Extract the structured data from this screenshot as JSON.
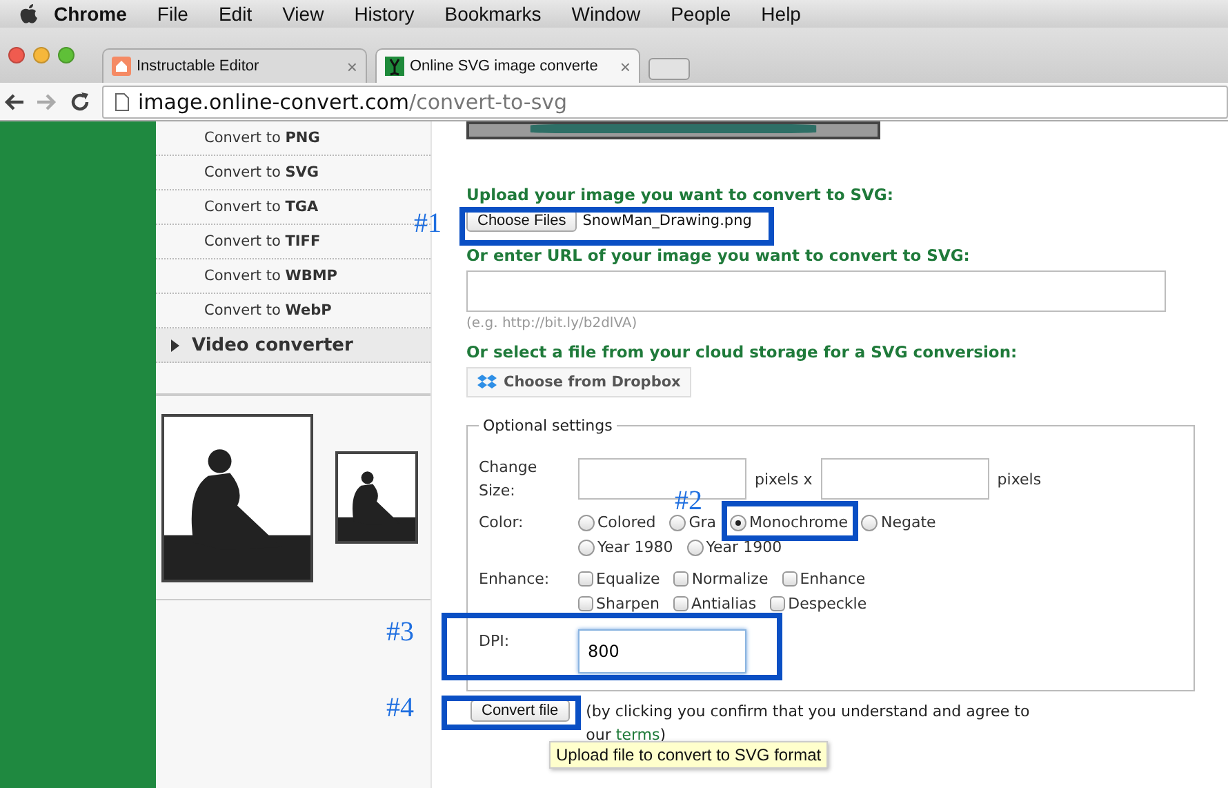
{
  "menu_bar": {
    "items": [
      {
        "label": "Chrome",
        "kind": "app"
      },
      {
        "label": "File",
        "kind": "menu"
      },
      {
        "label": "Edit",
        "kind": "menu"
      },
      {
        "label": "View",
        "kind": "menu"
      },
      {
        "label": "History",
        "kind": "menu"
      },
      {
        "label": "Bookmarks",
        "kind": "menu"
      },
      {
        "label": "Window",
        "kind": "menu"
      },
      {
        "label": "People",
        "kind": "menu"
      },
      {
        "label": "Help",
        "kind": "menu"
      }
    ]
  },
  "tabs": [
    {
      "title": "Instructable Editor",
      "selected": false,
      "close": "×"
    },
    {
      "title": "Online SVG image converte",
      "selected": true,
      "close": "×"
    }
  ],
  "address_bar": {
    "host": "image.online-convert.com",
    "path": "/convert-to-svg"
  },
  "sidebar": {
    "items": [
      {
        "label": "Convert to **PNG**"
      },
      {
        "label": "Convert to **SVG**"
      },
      {
        "label": "Convert to **TGA**"
      },
      {
        "label": "Convert to **TIFF**"
      },
      {
        "label": "Convert to **WBMP**"
      },
      {
        "label": "Convert to **WebP**"
      }
    ],
    "section": {
      "label": "Video converter",
      "expanded": false
    }
  },
  "form": {
    "upload_label": "Upload your image you want to convert to SVG:",
    "choose_files_button": "Choose Files",
    "file_name": "SnowMan_Drawing.png",
    "url_label": "Or enter URL of your image you want to convert to SVG:",
    "url_hint": "(e.g. http://bit.ly/b2dlVA)",
    "cloud_label": "Or select a file from your cloud storage for a SVG conversion:",
    "dropbox_button": "Choose from Dropbox",
    "optional_settings": {
      "legend": "Optional settings",
      "size_label": "Change Size:",
      "size_unit_1": "pixels x",
      "size_unit_2": "pixels",
      "color_label": "Color:",
      "color_options": [
        {
          "label": "Colored",
          "selected": false
        },
        {
          "label": "Gra",
          "selected": false
        },
        {
          "label": "Monochrome",
          "selected": true
        },
        {
          "label": "Negate",
          "selected": false
        },
        {
          "label": "Year 1980",
          "selected": false
        },
        {
          "label": "Year 1900",
          "selected": false
        }
      ],
      "enhance_label": "Enhance:",
      "enhance_options": [
        {
          "label": "Equalize",
          "checked": false
        },
        {
          "label": "Normalize",
          "checked": false
        },
        {
          "label": "Enhance",
          "checked": false
        },
        {
          "label": "Sharpen",
          "checked": false
        },
        {
          "label": "Antialias",
          "checked": false
        },
        {
          "label": "Despeckle",
          "checked": false
        }
      ],
      "dpi_label": "DPI:",
      "dpi_value": "800"
    },
    "convert_button": "Convert file",
    "agreement": "(by clicking you confirm that you understand and agree to our",
    "terms_link": "terms",
    "agreement_end": ")"
  },
  "tooltip": "Upload file to convert to SVG format",
  "annotations": [
    "#1",
    "#2",
    "#3",
    "#4"
  ]
}
